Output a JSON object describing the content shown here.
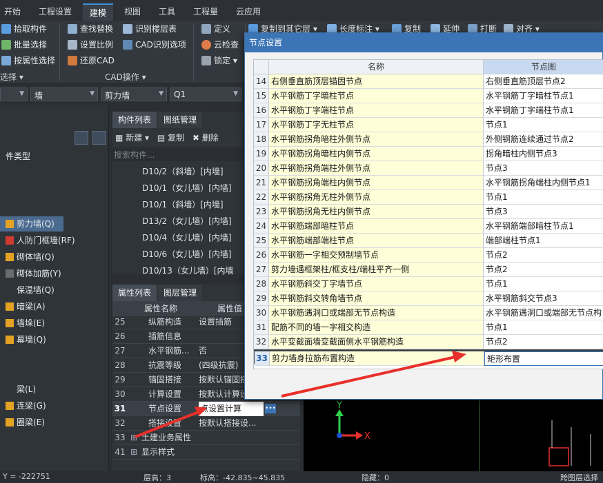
{
  "menu": [
    "开始",
    "工程设置",
    "建模",
    "视图",
    "工具",
    "工程量",
    "云应用"
  ],
  "ribbon": {
    "col1": [
      "拾取构件",
      "批量选择",
      "按属性选择"
    ],
    "col1_group": "选择",
    "col2": [
      "查找替换",
      "设置比例",
      "还原CAD"
    ],
    "col3": [
      "识别楼层表",
      "CAD识别选项"
    ],
    "cad_group": "CAD操作",
    "col4": [
      "定义",
      "云检查",
      "锁定"
    ],
    "col5": [
      "复制到其它层",
      "长度标注",
      "复制",
      "延伸",
      "打断",
      "对齐"
    ]
  },
  "selectors": [
    "墙",
    "剪力墙",
    "Q1"
  ],
  "left_panel": {
    "header": "件类型",
    "items": [
      {
        "label": "剪力墙(Q)",
        "active": true
      },
      {
        "label": "人防门框墙(RF)"
      },
      {
        "label": "砌体墙(Q)"
      },
      {
        "label": "砌体加筋(Y)"
      },
      {
        "label": "保温墙(Q)"
      },
      {
        "label": "暗梁(A)"
      },
      {
        "label": "墙垛(E)"
      },
      {
        "label": "幕墙(Q)"
      },
      {
        "label": "梁(L)"
      },
      {
        "label": "连梁(G)"
      },
      {
        "label": "圈梁(E)"
      }
    ]
  },
  "component_list": {
    "tabs": [
      "构件列表",
      "图纸管理"
    ],
    "toolbar": [
      "新建",
      "复制",
      "删除"
    ],
    "search_placeholder": "搜索构件...",
    "items": [
      "D10/2（斜墙）[内墙]",
      "D10/1（女儿墙）[内墙]",
      "D10/1（斜墙）[内墙]",
      "D13/2（女儿墙）[内墙]",
      "D10/4（女儿墙）[内墙]",
      "D10/6（女儿墙）[内墙]",
      "D10/13（女儿墙）[内墙"
    ]
  },
  "property_panel": {
    "tabs": [
      "属性列表",
      "图层管理"
    ],
    "col_name": "属性名称",
    "col_value": "属性值",
    "rows": [
      {
        "num": "25",
        "name": "纵筋构造",
        "value": "设置插筋"
      },
      {
        "num": "26",
        "name": "插筋信息",
        "value": ""
      },
      {
        "num": "27",
        "name": "水平钢筋...",
        "value": "否"
      },
      {
        "num": "28",
        "name": "抗震等级",
        "value": "(四级抗震)"
      },
      {
        "num": "29",
        "name": "锚固搭接",
        "value": "按默认锚固搭"
      },
      {
        "num": "30",
        "name": "计算设置",
        "value": "按默认计算设"
      },
      {
        "num": "31",
        "name": "节点设置",
        "value": "点设置计算"
      },
      {
        "num": "32",
        "name": "搭接设置",
        "value": "按默认搭接设..."
      },
      {
        "num": "33",
        "name": "土建业务属性",
        "value": ""
      },
      {
        "num": "41",
        "name": "显示样式",
        "value": ""
      }
    ]
  },
  "dialog": {
    "title": "节点设置",
    "col_name": "名称",
    "col_value": "节点图",
    "rows": [
      {
        "num": "14",
        "name": "右侧垂直筋顶层锚固节点",
        "value": "右侧垂直筋顶层节点2"
      },
      {
        "num": "15",
        "name": "水平钢筋丁字暗柱节点",
        "value": "水平钢筋丁字暗柱节点1"
      },
      {
        "num": "16",
        "name": "水平钢筋丁字端柱节点",
        "value": "水平钢筋丁字端柱节点1"
      },
      {
        "num": "17",
        "name": "水平钢筋丁字无柱节点",
        "value": "节点1"
      },
      {
        "num": "18",
        "name": "水平钢筋拐角暗柱外侧节点",
        "value": "外侧钢筋连续通过节点2"
      },
      {
        "num": "19",
        "name": "水平钢筋拐角暗柱内侧节点",
        "value": "拐角暗柱内侧节点3"
      },
      {
        "num": "20",
        "name": "水平钢筋拐角端柱外侧节点",
        "value": "节点3"
      },
      {
        "num": "21",
        "name": "水平钢筋拐角端柱内侧节点",
        "value": "水平钢筋拐角端柱内侧节点1"
      },
      {
        "num": "22",
        "name": "水平钢筋拐角无柱外侧节点",
        "value": "节点1"
      },
      {
        "num": "23",
        "name": "水平钢筋拐角无柱内侧节点",
        "value": "节点3"
      },
      {
        "num": "24",
        "name": "水平钢筋端部暗柱节点",
        "value": "水平钢筋端部暗柱节点1"
      },
      {
        "num": "25",
        "name": "水平钢筋端部端柱节点",
        "value": "端部端柱节点1"
      },
      {
        "num": "26",
        "name": "水平钢筋一字相交预制墙节点",
        "value": "节点2"
      },
      {
        "num": "27",
        "name": "剪力墙遇框架柱/框支柱/端柱平齐一侧",
        "value": "节点2"
      },
      {
        "num": "28",
        "name": "水平钢筋斜交丁字墙节点",
        "value": "节点1"
      },
      {
        "num": "29",
        "name": "水平钢筋斜交转角墙节点",
        "value": "水平钢筋斜交节点3"
      },
      {
        "num": "30",
        "name": "水平钢筋遇洞口或端部无节点构造",
        "value": "水平钢筋遇洞口或端部无节点构"
      },
      {
        "num": "31",
        "name": "配筋不同的墙一字相交构造",
        "value": "节点1"
      },
      {
        "num": "32",
        "name": "水平变截面墙变截面侧水平钢筋构造",
        "value": "节点2"
      },
      {
        "num": "33",
        "name": "剪力墙身拉筋布置构造",
        "value": "矩形布置",
        "selected": true
      }
    ]
  },
  "status": {
    "coord": "Y = -222751",
    "layer": "层高：3",
    "elevation": "标高：-42.835~45.835",
    "hidden": "隐藏：0",
    "cross": "跨图层选择"
  },
  "colors": {
    "title_blue": "#3c75b6",
    "row_yellow": "#fefed8",
    "arrow_red": "#e8302a"
  }
}
